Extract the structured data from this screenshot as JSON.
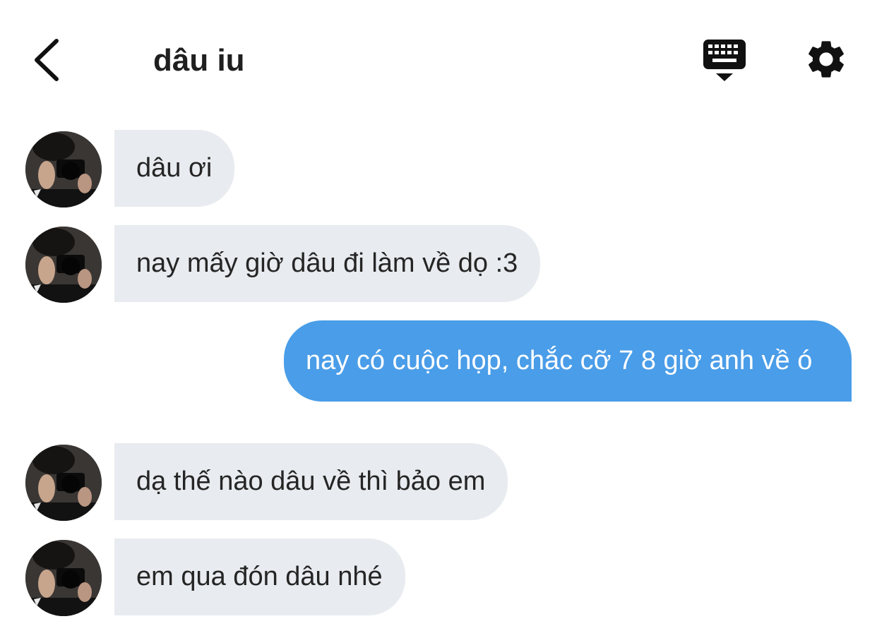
{
  "header": {
    "title": "dâu iu",
    "back_icon": "chevron-left-icon",
    "keyboard_icon": "keyboard-icon",
    "settings_icon": "gear-icon"
  },
  "messages": [
    {
      "side": "incoming",
      "text": "dâu ơi"
    },
    {
      "side": "incoming",
      "text": "nay mấy giờ dâu đi làm về dọ :3"
    },
    {
      "side": "outgoing",
      "text": "nay có cuộc họp, chắc cỡ 7 8 giờ anh về ó"
    },
    {
      "side": "incoming",
      "text": "dạ thế nào dâu về thì bảo em"
    },
    {
      "side": "incoming",
      "text": "em qua đón dâu nhé"
    }
  ],
  "colors": {
    "incoming_bubble": "#e8ebef",
    "outgoing_bubble": "#4a9de8",
    "icon": "#111111"
  }
}
